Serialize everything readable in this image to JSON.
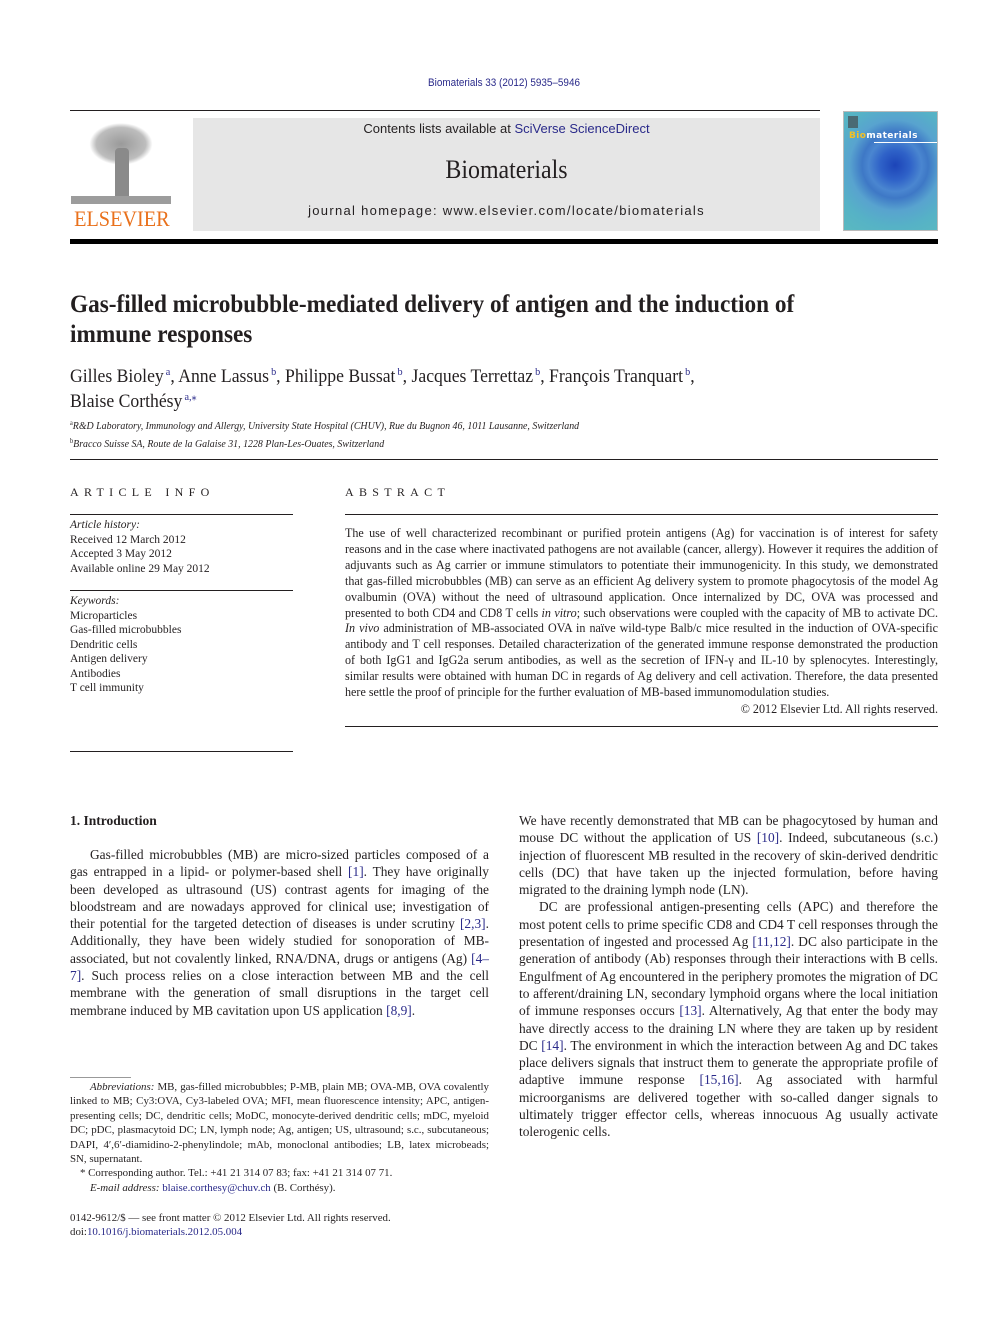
{
  "header": {
    "journal_ref": "Biomaterials 33 (2012) 5935–5946",
    "publisher_wordmark": "ELSEVIER",
    "contents_prefix": "Contents lists available at ",
    "contents_link": "SciVerse ScienceDirect",
    "journal_title": "Biomaterials",
    "homepage": "journal homepage: www.elsevier.com/locate/biomaterials",
    "cover": {
      "title_accent": "Bio",
      "title_rest": "materials"
    }
  },
  "article": {
    "title": "Gas-filled microbubble-mediated delivery of antigen and the induction of immune responses",
    "authors": [
      {
        "name": "Gilles Bioley",
        "aff": "a"
      },
      {
        "name": "Anne Lassus",
        "aff": "b"
      },
      {
        "name": "Philippe Bussat",
        "aff": "b"
      },
      {
        "name": "Jacques Terrettaz",
        "aff": "b"
      },
      {
        "name": "François Tranquart",
        "aff": "b"
      },
      {
        "name": "Blaise Corthésy",
        "aff": "a,⁎"
      }
    ],
    "affiliations": [
      {
        "mark": "a",
        "text": "R&D Laboratory, Immunology and Allergy, University State Hospital (CHUV), Rue du Bugnon 46, 1011 Lausanne, Switzerland"
      },
      {
        "mark": "b",
        "text": "Bracco Suisse SA, Route de la Galaise 31, 1228 Plan-Les-Ouates, Switzerland"
      }
    ]
  },
  "article_info": {
    "heading": "ARTICLE INFO",
    "history_label": "Article history:",
    "history": [
      "Received 12 March 2012",
      "Accepted 3 May 2012",
      "Available online 29 May 2012"
    ],
    "keywords_label": "Keywords:",
    "keywords": [
      "Microparticles",
      "Gas-filled microbubbles",
      "Dendritic cells",
      "Antigen delivery",
      "Antibodies",
      "T cell immunity"
    ]
  },
  "abstract": {
    "heading": "ABSTRACT",
    "part1": "The use of well characterized recombinant or purified protein antigens (Ag) for vaccination is of interest for safety reasons and in the case where inactivated pathogens are not available (cancer, allergy). However it requires the addition of adjuvants such as Ag carrier or immune stimulators to potentiate their immunogenicity. In this study, we demonstrated that gas-filled microbubbles (MB) can serve as an efficient Ag delivery system to promote phagocytosis of the model Ag ovalbumin (OVA) without the need of ultrasound application. Once internalized by DC, OVA was processed and presented to both CD4 and CD8 T cells ",
    "italic1": "in vitro",
    "part2": "; such observations were coupled with the capacity of MB to activate DC. ",
    "italic2": "In vivo",
    "part3": " administration of MB-associated OVA in naïve wild-type Balb/c mice resulted in the induction of OVA-specific antibody and T cell responses. Detailed characterization of the generated immune response demonstrated the production of both IgG1 and IgG2a serum antibodies, as well as the secretion of IFN-γ and IL-10 by splenocytes. Interestingly, similar results were obtained with human DC in regards of Ag delivery and cell activation. Therefore, the data presented here settle the proof of principle for the further evaluation of MB-based immunomodulation studies.",
    "copyright": "© 2012 Elsevier Ltd. All rights reserved."
  },
  "body": {
    "section_heading": "1.  Introduction",
    "left_p1": [
      {
        "t": "Gas-filled microbubbles (MB) are micro-sized particles composed of a gas entrapped in a lipid- or polymer-based shell "
      },
      {
        "ref": "[1]"
      },
      {
        "t": ". They have originally been developed as ultrasound (US) contrast agents for imaging of the bloodstream and are nowadays approved for clinical use; investigation of their potential for the targeted detection of diseases is under scrutiny "
      },
      {
        "ref": "[2,3]"
      },
      {
        "t": ". Additionally, they have been widely studied for sonoporation of MB-associated, but not covalently linked, RNA/DNA, drugs or antigens (Ag) "
      },
      {
        "ref": "[4–7]"
      },
      {
        "t": ". Such process relies on a close interaction between MB and the cell membrane with the generation of small disruptions in the target cell membrane induced by MB cavitation upon US application "
      },
      {
        "ref": "[8,9]"
      },
      {
        "t": "."
      }
    ],
    "right_p1": [
      {
        "t": "We have recently demonstrated that MB can be phagocytosed by human and mouse DC without the application of US "
      },
      {
        "ref": "[10]"
      },
      {
        "t": ". Indeed, subcutaneous (s.c.) injection of fluorescent MB resulted in the recovery of skin-derived dendritic cells (DC) that have taken up the injected formulation, before having migrated to the draining lymph node (LN)."
      }
    ],
    "right_p2": [
      {
        "t": "DC are professional antigen-presenting cells (APC) and therefore the most potent cells to prime specific CD8 and CD4 T cell responses through the presentation of ingested and processed Ag "
      },
      {
        "ref": "[11,12]"
      },
      {
        "t": ". DC also participate in the generation of antibody (Ab) responses through their interactions with B cells. Engulfment of Ag encountered in the periphery promotes the migration of DC to afferent/draining LN, secondary lymphoid organs where the local initiation of immune responses occurs "
      },
      {
        "ref": "[13]"
      },
      {
        "t": ". Alternatively, Ag that enter the body may have directly access to the draining LN where they are taken up by resident DC "
      },
      {
        "ref": "[14]"
      },
      {
        "t": ". The environment in which the interaction between Ag and DC takes place delivers signals that instruct them to generate the appropriate profile of adaptive immune response "
      },
      {
        "ref": "[15,16]"
      },
      {
        "t": ". Ag associated with harmful microorganisms are delivered together with so-called danger signals to ultimately trigger effector cells, whereas innocuous Ag usually activate tolerogenic cells."
      }
    ]
  },
  "footnotes": {
    "abbrev_label": "Abbreviations:",
    "abbrev_text": " MB, gas-filled microbubbles; P-MB, plain MB; OVA-MB, OVA covalently linked to MB; Cy3:OVA, Cy3-labeled OVA; MFI, mean fluorescence intensity; APC, antigen-presenting cells; DC, dendritic cells; MoDC, monocyte-derived dendritic cells; mDC, myeloid DC; pDC, plasmacytoid DC; LN, lymph node; Ag, antigen; US, ultrasound; s.c., subcutaneous; DAPI, 4′,6′-diamidino-2-phenylindole; mAb, monoclonal antibodies; LB, latex microbeads; SN, supernatant.",
    "corresponding": "* Corresponding author. Tel.: +41 21 314 07 83; fax: +41 21 314 07 71.",
    "email_label": "E-mail address:",
    "email": "blaise.corthesy@chuv.ch",
    "email_suffix": " (B. Corthésy)."
  },
  "frontmatter": {
    "issn_line": "0142-9612/$ — see front matter © 2012 Elsevier Ltd. All rights reserved.",
    "doi_prefix": "doi:",
    "doi": "10.1016/j.biomaterials.2012.05.004"
  }
}
